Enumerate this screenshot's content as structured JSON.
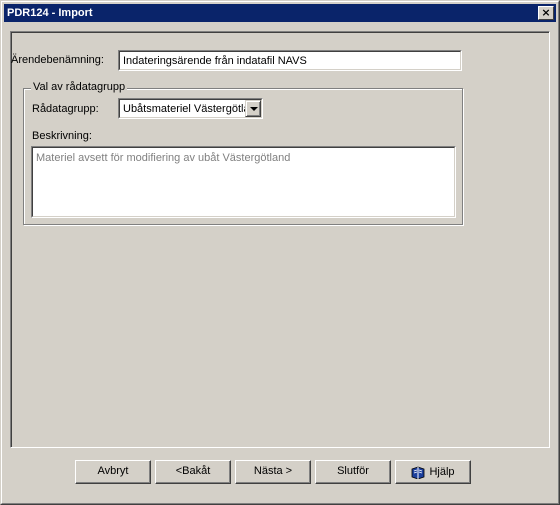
{
  "window": {
    "title": "PDR124 - Import",
    "close_glyph": "×"
  },
  "form": {
    "case_name_label": "Ärendebenämning:",
    "case_name_value": "Indateringsärende från indatafil NAVS",
    "group": {
      "legend": "Val av rådatagrupp",
      "group_label": "Rådatagrupp:",
      "group_value": "Ubåtsmateriel Västergötla",
      "description_label": "Beskrivning:",
      "description_value": "Materiel avsett för modifiering av ubåt Västergötland"
    }
  },
  "buttons": {
    "cancel": "Avbryt",
    "back": "<Bakåt",
    "next": "Nästa >",
    "finish": "Slutför",
    "help": "Hjälp",
    "help_icon": "help-book-icon"
  }
}
